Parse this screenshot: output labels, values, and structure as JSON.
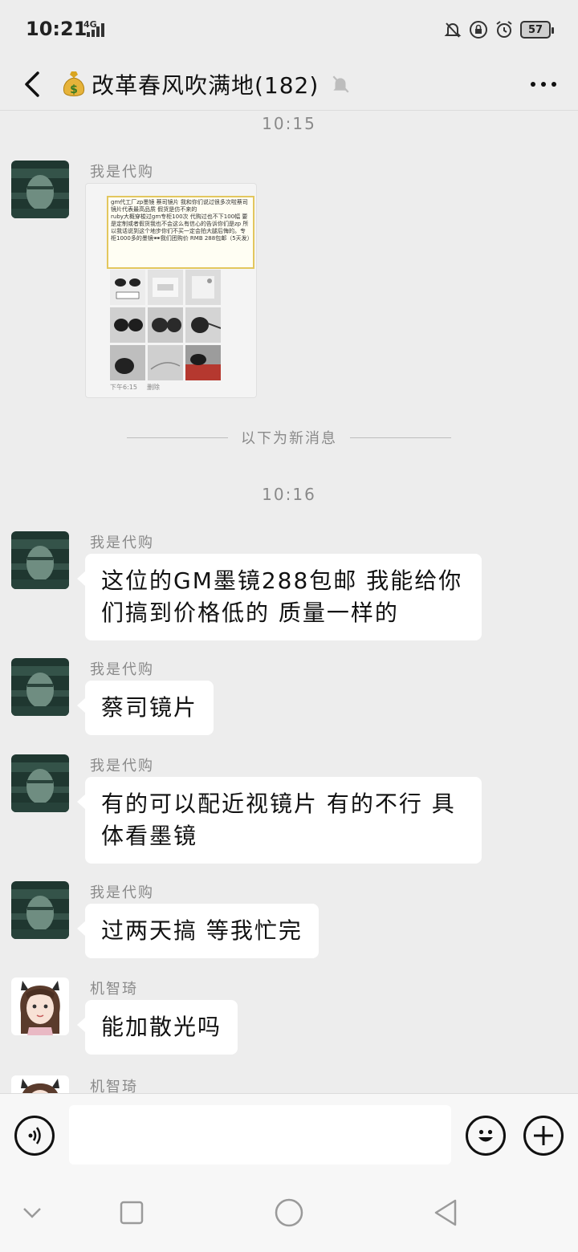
{
  "status_bar": {
    "time": "10:21",
    "network": "4G",
    "battery": "57",
    "icons": [
      "bell-off-icon",
      "lock-icon",
      "alarm-icon",
      "battery-icon"
    ]
  },
  "header": {
    "title": "改革春风吹满地(182)",
    "title_icon": "money-bag-icon",
    "muted_icon": "bell-off-icon",
    "back_icon": "chevron-left-icon",
    "more_icon": "more-icon"
  },
  "chat": {
    "timestamp_1": "10:15",
    "divider": "以下为新消息",
    "timestamp_2": "10:16",
    "image_message": {
      "sender": "我是代购",
      "note": "gm代工厂zp墨镜 蔡司镜片 我和你们说过很多次啦蔡司镜片代表最高品质 假货是仿不来的\nruby大概穿梭过gm专柜100次 代购过也不下100幅 要是定制或者假货我也不会这么有信心的告诉你们是zp 所以我话说到这个地步你们不买一定会拍大腿后悔的。专柜1000多的墨镜🕶我们团购价 RMB 288包邮（5天发）",
      "caption_time": "下午6:15",
      "caption_action": "删除"
    },
    "messages": [
      {
        "sender": "我是代购",
        "text": "这位的GM墨镜288包邮 我能给你们搞到价格低的 质量一样的"
      },
      {
        "sender": "我是代购",
        "text": "蔡司镜片"
      },
      {
        "sender": "我是代购",
        "text": "有的可以配近视镜片 有的不行 具体看墨镜"
      },
      {
        "sender": "我是代购",
        "text": "过两天搞 等我忙完"
      },
      {
        "sender": "机智琦",
        "text": "能加散光吗"
      },
      {
        "sender": "机智琦",
        "text": ""
      }
    ]
  },
  "input_bar": {
    "voice_icon": "voice-icon",
    "input_value": "",
    "emoji_icon": "emoji-icon",
    "plus_icon": "plus-icon"
  },
  "nav_bar": {
    "icons": [
      "nav-collapse-icon",
      "nav-recent-icon",
      "nav-home-icon",
      "nav-back-icon"
    ]
  },
  "colors": {
    "background": "#ededed",
    "bubble": "#ffffff",
    "timestamp": "#8a8a8a",
    "note_border": "#e3c75e"
  }
}
